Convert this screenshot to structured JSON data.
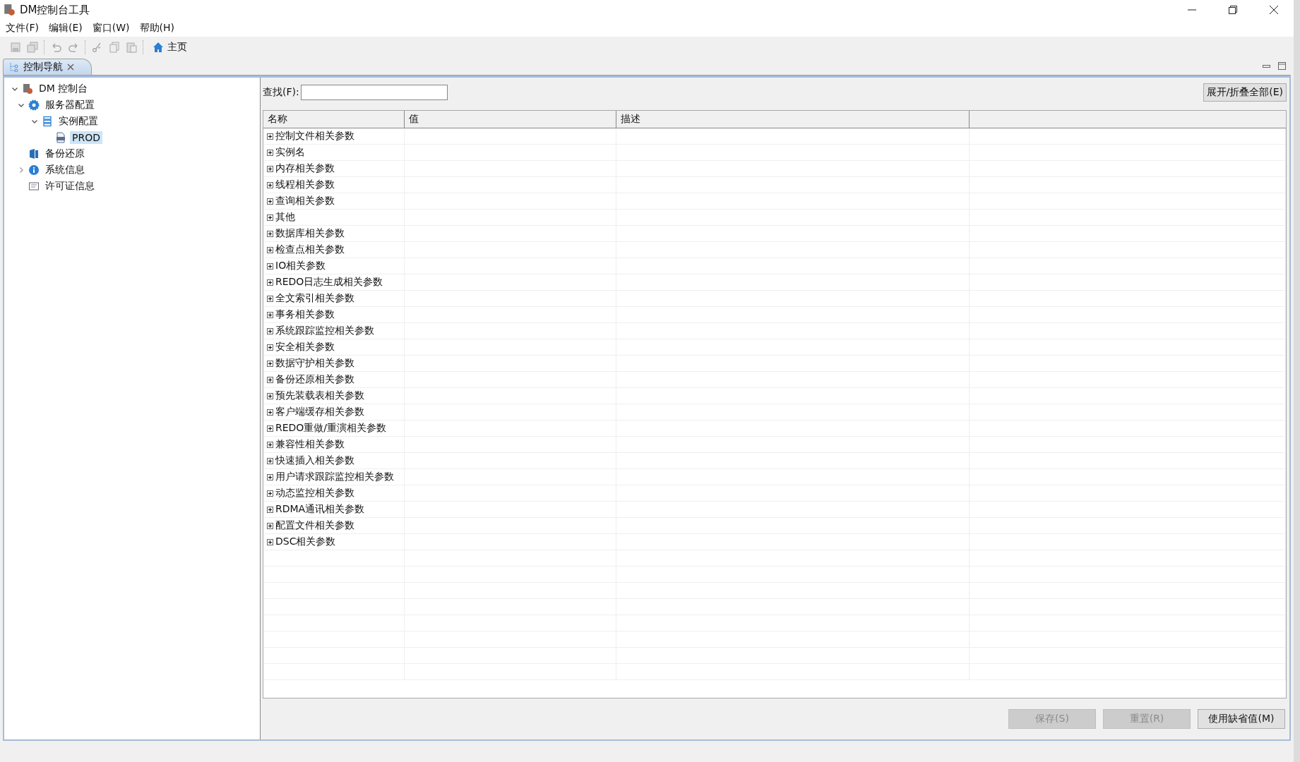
{
  "window": {
    "title": "DM控制台工具"
  },
  "menu": [
    "文件(F)",
    "编辑(E)",
    "窗口(W)",
    "帮助(H)"
  ],
  "toolbar": {
    "home_label": "主页"
  },
  "view_tab": {
    "label": "控制导航"
  },
  "tree": [
    {
      "label": "DM 控制台",
      "kind": "app",
      "expanded": true,
      "selected": false,
      "children": [
        {
          "label": "服务器配置",
          "kind": "gear",
          "expanded": true,
          "selected": false,
          "children": [
            {
              "label": "实例配置",
              "kind": "list",
              "expanded": true,
              "selected": false,
              "children": [
                {
                  "label": "PROD",
                  "kind": "ini",
                  "selected": true
                }
              ]
            }
          ]
        },
        {
          "label": "备份还原",
          "kind": "backup",
          "selected": false
        },
        {
          "label": "系统信息",
          "kind": "info",
          "expanded": false,
          "selected": false
        },
        {
          "label": "许可证信息",
          "kind": "license",
          "selected": false
        }
      ]
    }
  ],
  "search": {
    "label": "查找(F):"
  },
  "expand_all_button": "展开/折叠全部(E)",
  "table": {
    "columns": [
      "名称",
      "值",
      "描述"
    ],
    "rows": [
      "控制文件相关参数",
      "实例名",
      "内存相关参数",
      "线程相关参数",
      "查询相关参数",
      "其他",
      "数据库相关参数",
      "检查点相关参数",
      "IO相关参数",
      "REDO日志生成相关参数",
      "全文索引相关参数",
      "事务相关参数",
      "系统跟踪监控相关参数",
      "安全相关参数",
      "数据守护相关参数",
      "备份还原相关参数",
      "预先装载表相关参数",
      "客户端缓存相关参数",
      "REDO重做/重演相关参数",
      "兼容性相关参数",
      "快速插入相关参数",
      "用户请求跟踪监控相关参数",
      "动态监控相关参数",
      "RDMA通讯相关参数",
      "配置文件相关参数",
      "DSC相关参数"
    ]
  },
  "buttons": [
    {
      "label": "保存(S)",
      "disabled": true
    },
    {
      "label": "重置(R)",
      "disabled": true
    },
    {
      "label": "使用缺省值(M)",
      "disabled": false
    }
  ]
}
